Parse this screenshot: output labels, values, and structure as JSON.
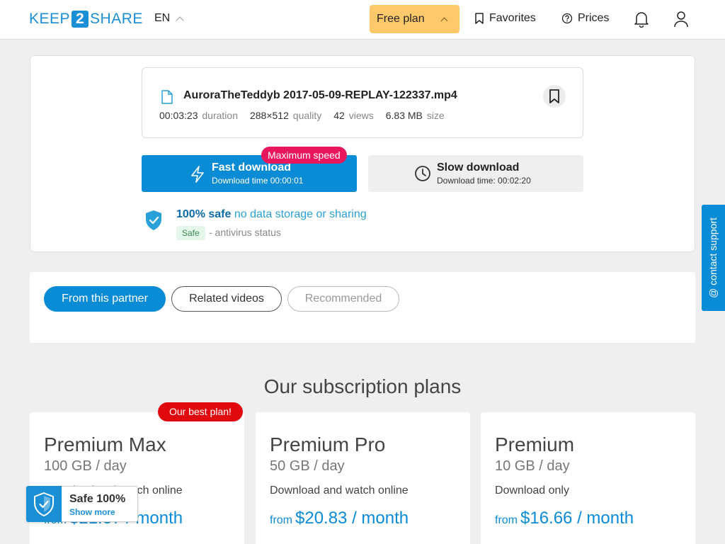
{
  "header": {
    "logo_left": "KEEP",
    "logo_mid": "2",
    "logo_right": "SHARE",
    "lang": "EN",
    "free_plan": "Free plan",
    "favorites": "Favorites",
    "prices": "Prices"
  },
  "file": {
    "name": "AuroraTheTeddyb 2017-05-09-REPLAY-122337.mp4",
    "duration_value": "00:03:23",
    "duration_label": "duration",
    "quality_value": "288×512",
    "quality_label": "quality",
    "views_value": "42",
    "views_label": "views",
    "size_value": "6.83 MB",
    "size_label": "size"
  },
  "download": {
    "fast_label": "Fast download",
    "fast_time": "Download time 00:00:01",
    "max_speed_badge": "Maximum speed",
    "slow_label": "Slow download",
    "slow_time": "Download time: 00:02:20"
  },
  "safety": {
    "headline_bold": "100% safe",
    "headline_rest": "no data storage or sharing",
    "badge": "Safe",
    "antivirus": "- antivirus status"
  },
  "tabs": {
    "partner": "From this partner",
    "related": "Related videos",
    "recommended": "Recommended"
  },
  "plans": {
    "title": "Our subscription plans",
    "best_badge": "Our best plan!",
    "items": [
      {
        "name": "Premium Max",
        "quota": "100 GB / day",
        "desc": "Download and watch online",
        "from": "from",
        "price": "$21.37 / month"
      },
      {
        "name": "Premium Pro",
        "quota": "50 GB / day",
        "desc": "Download and watch online",
        "from": "from",
        "price": "$20.83 / month"
      },
      {
        "name": "Premium",
        "quota": "10 GB / day",
        "desc": "Download only",
        "from": "from",
        "price": "$16.66 / month"
      }
    ]
  },
  "safe_widget": {
    "title": "Safe 100%",
    "link": "Show more"
  },
  "contact_support": "contact support",
  "colors": {
    "brand_blue": "#0a8bd6",
    "free_plan_bg": "#fdc96a",
    "max_speed_badge": "#e8175d",
    "best_plan_badge": "#e0080d"
  }
}
